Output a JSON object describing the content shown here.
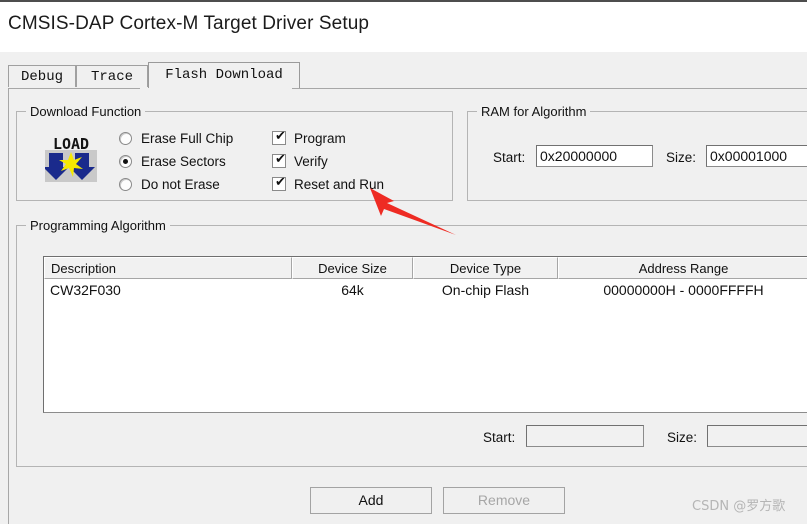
{
  "window": {
    "title": "CMSIS-DAP Cortex-M Target Driver Setup"
  },
  "tabs": [
    {
      "label": "Debug",
      "selected": false
    },
    {
      "label": "Trace",
      "selected": false
    },
    {
      "label": "Flash Download",
      "selected": true
    }
  ],
  "download_function": {
    "legend": "Download Function",
    "icon_name": "load-icon",
    "icon_text": "LOAD",
    "erase_options": [
      {
        "label": "Erase Full Chip",
        "selected": false
      },
      {
        "label": "Erase Sectors",
        "selected": true
      },
      {
        "label": "Do not Erase",
        "selected": false
      }
    ],
    "checkboxes": [
      {
        "label": "Program",
        "checked": true
      },
      {
        "label": "Verify",
        "checked": true
      },
      {
        "label": "Reset and Run",
        "checked": true
      }
    ],
    "check_glyph": "✔"
  },
  "ram_for_algorithm": {
    "legend": "RAM for Algorithm",
    "start_label": "Start:",
    "start_value": "0x20000000",
    "size_label": "Size:",
    "size_value": "0x00001000"
  },
  "programming_algorithm": {
    "legend": "Programming Algorithm",
    "columns": [
      {
        "header": "Description",
        "align": "left"
      },
      {
        "header": "Device Size",
        "align": "center"
      },
      {
        "header": "Device Type",
        "align": "center"
      },
      {
        "header": "Address Range",
        "align": "center"
      },
      {
        "header": "",
        "align": "center"
      }
    ],
    "rows": [
      {
        "description": "CW32F030",
        "device_size": "64k",
        "device_type": "On-chip Flash",
        "address_range": "00000000H - 0000FFFFH",
        "extra": ""
      }
    ],
    "start_label": "Start:",
    "start_value": "",
    "start_placeholder": "",
    "size_label": "Size:",
    "size_value": "",
    "size_placeholder": ""
  },
  "buttons": {
    "add": "Add",
    "remove": "Remove"
  },
  "annotation": {
    "name": "red-arrow-pointer",
    "color": "#ee2b23",
    "points_at": "Reset and Run"
  },
  "watermark": {
    "text": "CSDN @罗方歌"
  },
  "colors": {
    "dialog_background": "#f0f0f0",
    "group_border": "#b4b4b4",
    "field_background": "#ffffff",
    "annotation_red": "#ee2b23",
    "watermark_gray": "#b5b5b5"
  }
}
